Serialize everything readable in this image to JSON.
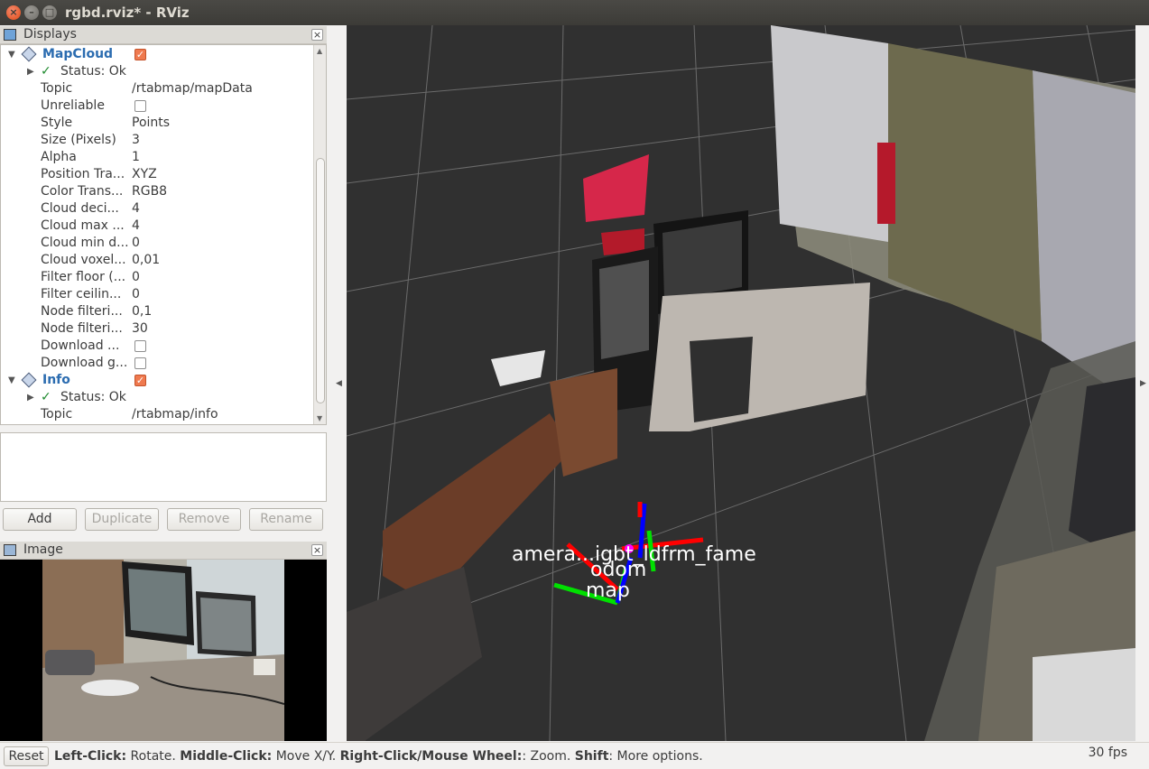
{
  "window": {
    "title": "rgbd.rviz* - RViz",
    "close": "×",
    "minimize": "–",
    "maximize": "□"
  },
  "displays_panel": {
    "title": "Displays",
    "close": "×",
    "rows": [
      {
        "kind": "display",
        "name": "MapCloud",
        "checked": true
      },
      {
        "kind": "status",
        "name": "Status: Ok"
      },
      {
        "kind": "prop",
        "name": "Topic",
        "value": "/rtabmap/mapData"
      },
      {
        "kind": "propcheck",
        "name": "Unreliable",
        "checked": false
      },
      {
        "kind": "prop",
        "name": "Style",
        "value": "Points"
      },
      {
        "kind": "prop",
        "name": "Size (Pixels)",
        "value": "3"
      },
      {
        "kind": "prop",
        "name": "Alpha",
        "value": "1"
      },
      {
        "kind": "prop",
        "name": "Position Tra...",
        "value": "XYZ"
      },
      {
        "kind": "prop",
        "name": "Color Trans...",
        "value": "RGB8"
      },
      {
        "kind": "prop",
        "name": "Cloud deci...",
        "value": "4"
      },
      {
        "kind": "prop",
        "name": "Cloud max ...",
        "value": "4"
      },
      {
        "kind": "prop",
        "name": "Cloud min d...",
        "value": "0"
      },
      {
        "kind": "prop",
        "name": "Cloud voxel...",
        "value": "0,01"
      },
      {
        "kind": "prop",
        "name": "Filter floor (...",
        "value": "0"
      },
      {
        "kind": "prop",
        "name": "Filter ceilin...",
        "value": "0"
      },
      {
        "kind": "prop",
        "name": "Node filteri...",
        "value": "0,1"
      },
      {
        "kind": "prop",
        "name": "Node filteri...",
        "value": "30"
      },
      {
        "kind": "propcheck",
        "name": "Download ...",
        "checked": false
      },
      {
        "kind": "propcheck",
        "name": "Download g...",
        "checked": false
      },
      {
        "kind": "display",
        "name": "Info",
        "checked": true
      },
      {
        "kind": "status",
        "name": "Status: Ok"
      },
      {
        "kind": "prop",
        "name": "Topic",
        "value": "/rtabmap/info"
      }
    ]
  },
  "buttons": {
    "add": "Add",
    "duplicate": "Duplicate",
    "remove": "Remove",
    "rename": "Rename"
  },
  "image_panel": {
    "title": "Image",
    "close": "×"
  },
  "viewport": {
    "frame_labels": {
      "overlap": "amera...igbt_ldfrm_fame",
      "odom": "odom",
      "map": "map"
    }
  },
  "statusbar": {
    "reset": "Reset",
    "help": [
      {
        "bold": "Left-Click:",
        "text": " Rotate. "
      },
      {
        "bold": "Middle-Click:",
        "text": " Move X/Y. "
      },
      {
        "bold": "Right-Click/Mouse Wheel:",
        "text": ": Zoom. "
      },
      {
        "bold": "Shift",
        "text": ": More options."
      }
    ],
    "fps": "30 fps"
  },
  "colors": {
    "accent_link": "#2b6cb0",
    "checkbox_on": "#ef7a4f",
    "viewport_bg": "#303030",
    "status_ok": "#1e8a2e"
  }
}
